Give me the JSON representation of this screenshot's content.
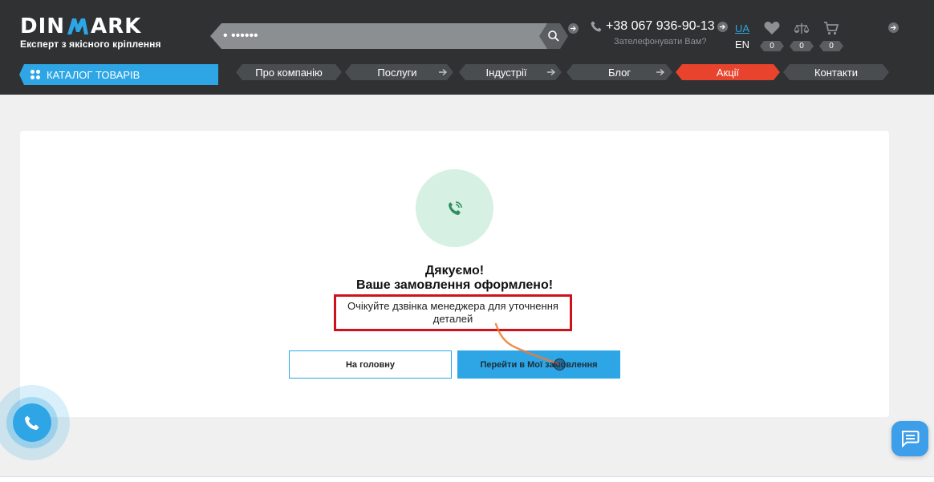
{
  "header": {
    "logo": {
      "left": "DIN",
      "right": "ARK",
      "tagline": "Експерт з якісного кріплення"
    },
    "search": {
      "value": "• ••••••",
      "placeholder": ""
    },
    "phone": {
      "number": "+38 067 936-90-13",
      "callback": "Зателефонувати Вам?"
    },
    "lang": {
      "active": "UA",
      "other": "EN"
    },
    "counters": {
      "wishlist": "0",
      "compare": "0",
      "cart": "0"
    }
  },
  "nav": {
    "catalog": "КАТАЛОГ ТОВАРІВ",
    "items": [
      {
        "label": "Про компанію"
      },
      {
        "label": "Послуги"
      },
      {
        "label": "Індустрії"
      },
      {
        "label": "Блог"
      },
      {
        "label": "Акції"
      },
      {
        "label": "Контакти"
      }
    ]
  },
  "confirmation": {
    "title": "Дякуємо!",
    "subtitle": "Ваше замовлення оформлено!",
    "description": "Очікуйте дзвінка менеджера для уточнення деталей",
    "home_button": "На головну",
    "orders_button": "Перейти в Мої замовлення"
  },
  "icons": {
    "success": "phone-check-icon",
    "call_widget": "phone-icon",
    "chat_widget": "chat-icon"
  },
  "colors": {
    "header_bg": "#2f3133",
    "accent": "#2ea6e6",
    "promo": "#e8432d",
    "success_bg": "#d6f0e3",
    "success_icon": "#2f8f5e",
    "highlight_border": "#d0111b"
  }
}
